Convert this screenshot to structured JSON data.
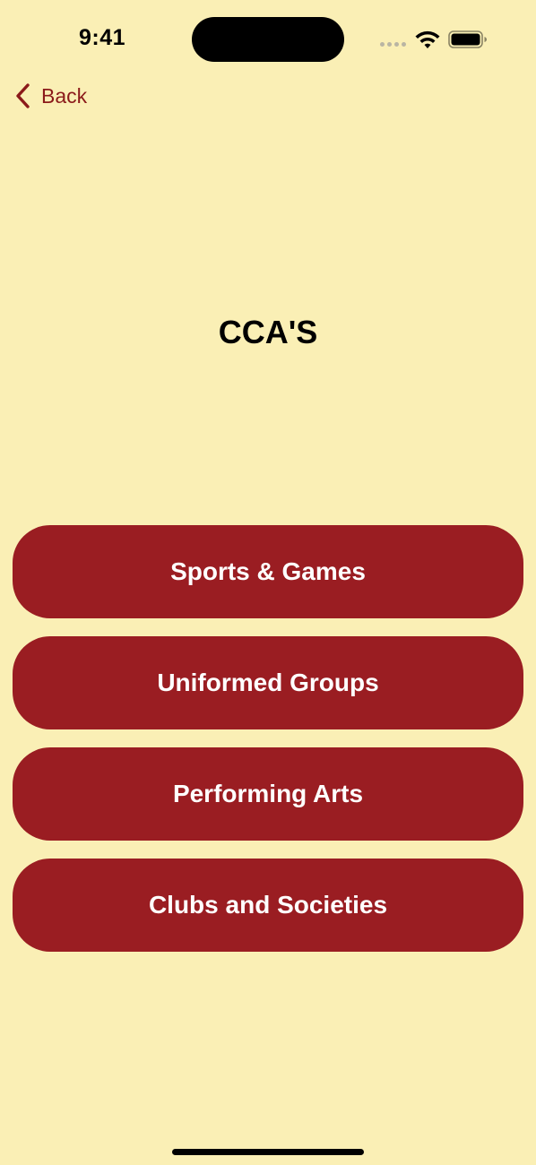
{
  "status_bar": {
    "time": "9:41"
  },
  "nav": {
    "back_label": "Back"
  },
  "page": {
    "title": "CCA'S"
  },
  "menu": {
    "items": [
      {
        "label": "Sports & Games"
      },
      {
        "label": "Uniformed Groups"
      },
      {
        "label": "Performing Arts"
      },
      {
        "label": "Clubs and Societies"
      }
    ]
  },
  "colors": {
    "background": "#FAEFB5",
    "accent": "#9A1D22",
    "back_tint": "#8B1A1A"
  }
}
